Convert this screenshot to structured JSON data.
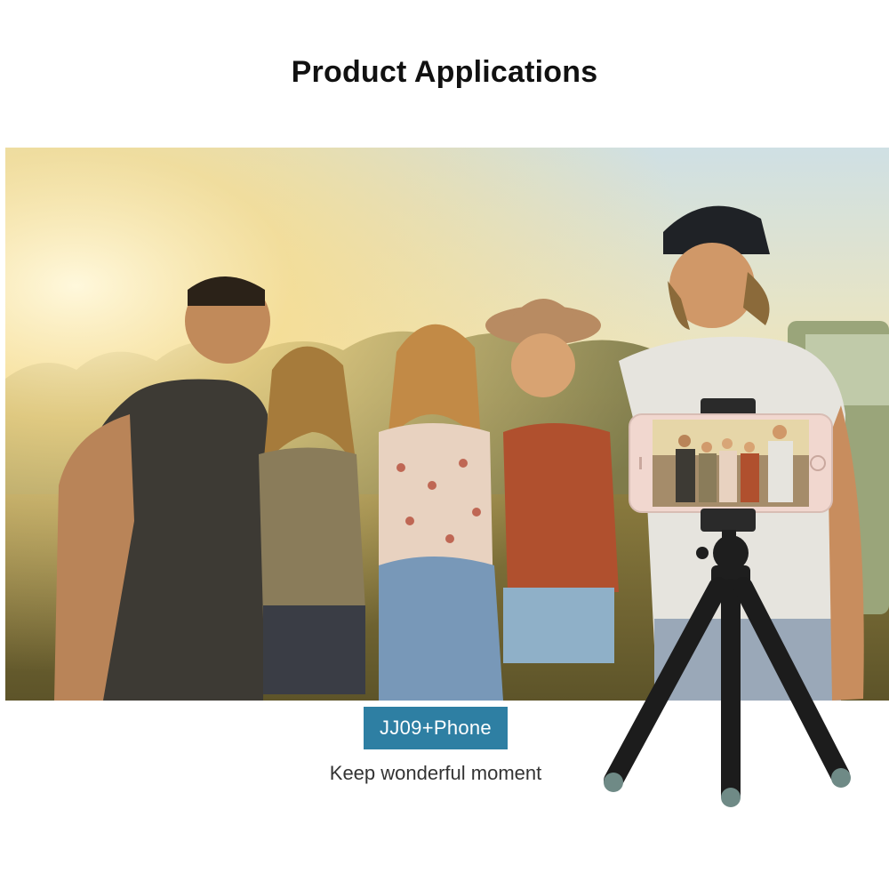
{
  "page": {
    "title": "Product Applications"
  },
  "product": {
    "badge_label": "JJ09+Phone",
    "badge_color": "#2e7fa3",
    "caption": "Keep wonderful moment"
  },
  "scene": {
    "subject": "five-friends-group-photo",
    "device": "phone-on-flexible-tripod"
  }
}
